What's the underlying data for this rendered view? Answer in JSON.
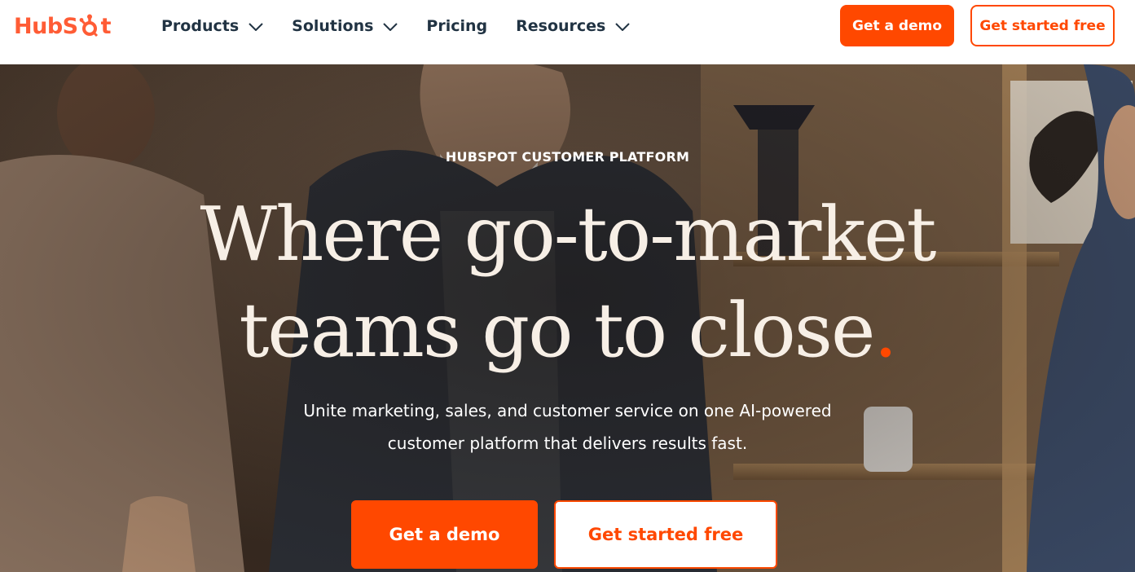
{
  "header": {
    "logo_text": "HubSpot",
    "nav": [
      {
        "label": "Products",
        "has_dropdown": true
      },
      {
        "label": "Solutions",
        "has_dropdown": true
      },
      {
        "label": "Pricing",
        "has_dropdown": false
      },
      {
        "label": "Resources",
        "has_dropdown": true
      }
    ],
    "demo_label": "Get a demo",
    "free_label": "Get started free"
  },
  "hero": {
    "eyebrow": "HUBSPOT CUSTOMER PLATFORM",
    "headline_line1": "Where go-to-market",
    "headline_line2": "teams go to close",
    "headline_dot": ".",
    "subtext": "Unite marketing, sales, and customer service on one AI-powered customer platform that delivers results fast.",
    "demo_label": "Get a demo",
    "free_label": "Get started free"
  },
  "colors": {
    "brand_orange": "#ff4800",
    "logo_orange": "#ff5c35",
    "nav_text": "#213343",
    "headline_text": "#f7efe6"
  },
  "icons": {
    "nav_dropdown": "chevron-down-icon",
    "logo_sprocket": "sprocket-icon"
  }
}
